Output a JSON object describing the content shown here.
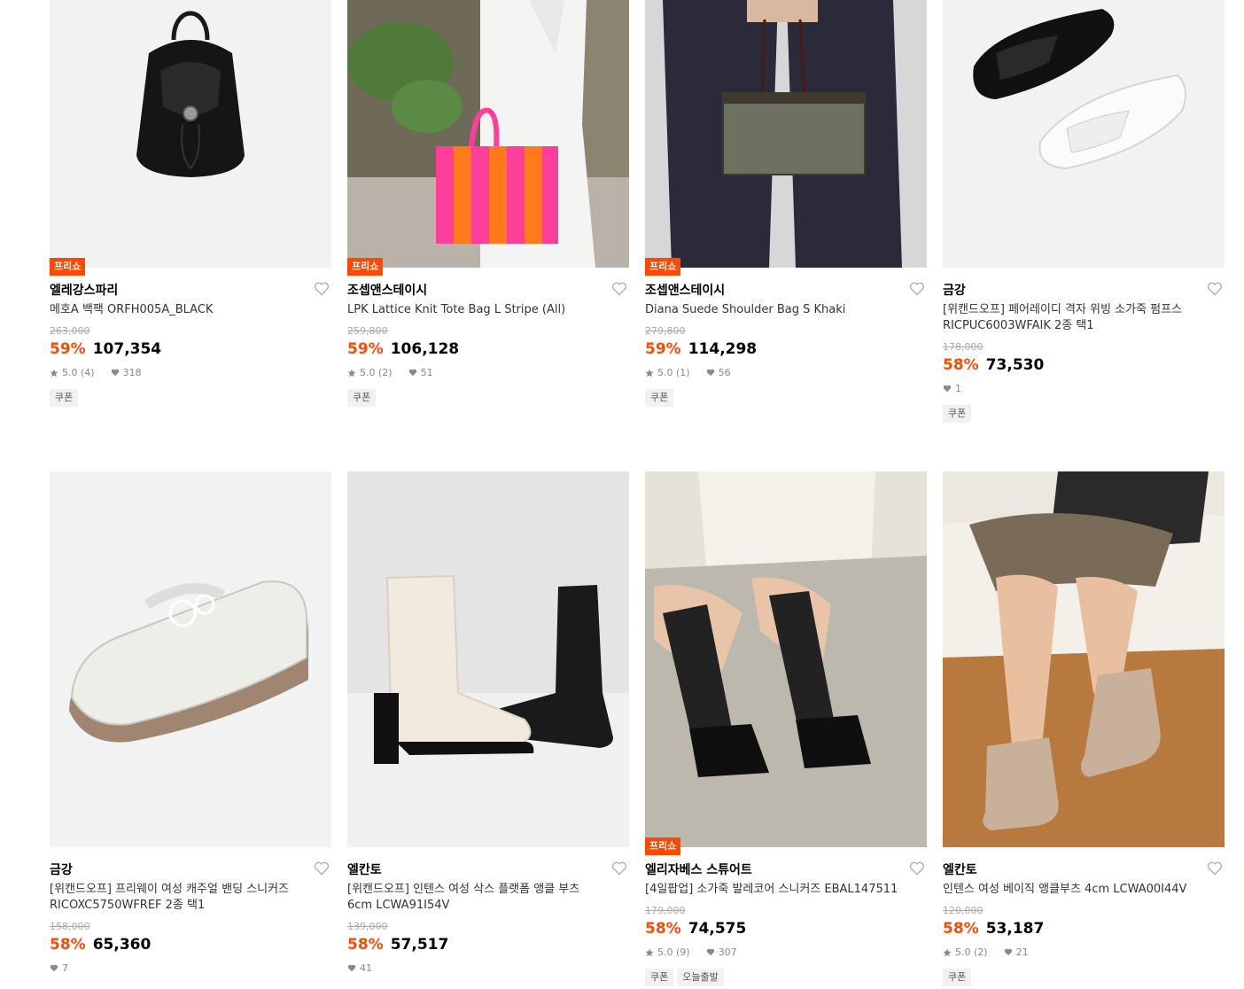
{
  "products": [
    {
      "brand": "엘레강스파리",
      "name": "메호A 백팩 ORFH005A_BLACK",
      "badge": "프리쇼",
      "original_price": "263,000",
      "discount": "59%",
      "price": "107,354",
      "rating": "5.0 (4)",
      "likes": "318",
      "tags": [
        "쿠폰"
      ]
    },
    {
      "brand": "조셉앤스테이시",
      "name": "LPK Lattice Knit Tote Bag L Stripe (All)",
      "badge": "프리쇼",
      "original_price": "259,800",
      "discount": "59%",
      "price": "106,128",
      "rating": "5.0 (2)",
      "likes": "51",
      "tags": [
        "쿠폰"
      ]
    },
    {
      "brand": "조셉앤스테이시",
      "name": "Diana Suede Shoulder Bag S Khaki",
      "badge": "프리쇼",
      "original_price": "279,800",
      "discount": "59%",
      "price": "114,298",
      "rating": "5.0 (1)",
      "likes": "56",
      "tags": [
        "쿠폰"
      ]
    },
    {
      "brand": "금강",
      "name": "[위캔드오프] 페어레이디 격자 위빙 소가죽 펌프스 RICPUC6003WFAIK 2종 택1",
      "badge": "",
      "original_price": "178,000",
      "discount": "58%",
      "price": "73,530",
      "rating": "",
      "likes": "1",
      "tags": [
        "쿠폰"
      ]
    },
    {
      "brand": "금강",
      "name": "[위캔드오프] 프리웨이 여성 캐주얼 밴딩 스니커즈 RICOXC5750WFREF 2종 택1",
      "badge": "",
      "original_price": "158,000",
      "discount": "58%",
      "price": "65,360",
      "rating": "",
      "likes": "7",
      "tags": []
    },
    {
      "brand": "엘칸토",
      "name": "[위캔드오프] 인텐스 여성 삭스 플랫폼 앵클 부츠 6cm LCWA91I54V",
      "badge": "",
      "original_price": "139,000",
      "discount": "58%",
      "price": "57,517",
      "rating": "",
      "likes": "41",
      "tags": []
    },
    {
      "brand": "엘리자베스 스튜어트",
      "name": "[4일팝업] 소가죽 발레코어 스니커즈 EBAL147511",
      "badge": "프리쇼",
      "original_price": "179,000",
      "discount": "58%",
      "price": "74,575",
      "rating": "5.0 (9)",
      "likes": "307",
      "tags": [
        "쿠폰",
        "오늘출발"
      ]
    },
    {
      "brand": "엘칸토",
      "name": "인텐스 여성 베이직 앵클부츠 4cm LCWA00I44V",
      "badge": "",
      "original_price": "120,000",
      "discount": "58%",
      "price": "53,187",
      "rating": "5.0 (2)",
      "likes": "21",
      "tags": [
        "쿠폰"
      ]
    }
  ],
  "colors": {
    "accent": "#ff4800",
    "text": "#000000",
    "muted": "#888888",
    "strike": "#aaaaaa",
    "tag_bg": "#f1f1f1"
  },
  "icons": {
    "wishlist": "heart-outline-icon",
    "rating": "star-icon",
    "likes": "heart-filled-icon"
  }
}
